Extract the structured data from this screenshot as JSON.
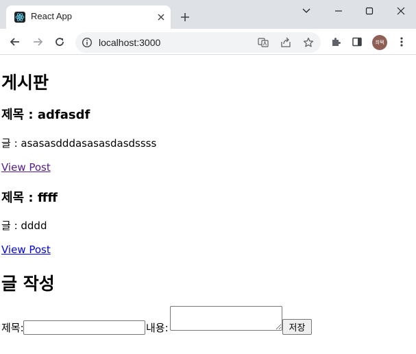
{
  "browser": {
    "tab": {
      "title": "React App"
    },
    "address_bar": {
      "url": "localhost:3000"
    },
    "profile": {
      "label": "희택"
    }
  },
  "page": {
    "heading": "게시판",
    "posts": [
      {
        "title": "제목 : adfasdf",
        "body": "글 : asasasdddasasasdasdssss",
        "link": "View Post"
      },
      {
        "title": "제목 : ffff",
        "body": "글 : dddd",
        "link": "View Post"
      }
    ],
    "form": {
      "heading": "글 작성",
      "title_label": "제목:",
      "title_value": "",
      "content_label": "내용:",
      "content_value": "",
      "submit_label": "저장"
    }
  },
  "colors": {
    "tabstrip_bg": "#dee1e6",
    "visited_link": "#551a8b",
    "unvisited_link": "#0000ee",
    "avatar_bg": "#8d5f55"
  },
  "icons": [
    "react-favicon-icon",
    "close-icon",
    "plus-icon",
    "chevron-down-icon",
    "minimize-icon",
    "maximize-icon",
    "window-close-icon",
    "back-icon",
    "forward-icon",
    "reload-icon",
    "site-info-icon",
    "translate-icon",
    "share-icon",
    "star-icon",
    "extensions-icon",
    "side-panel-icon",
    "menu-icon"
  ]
}
